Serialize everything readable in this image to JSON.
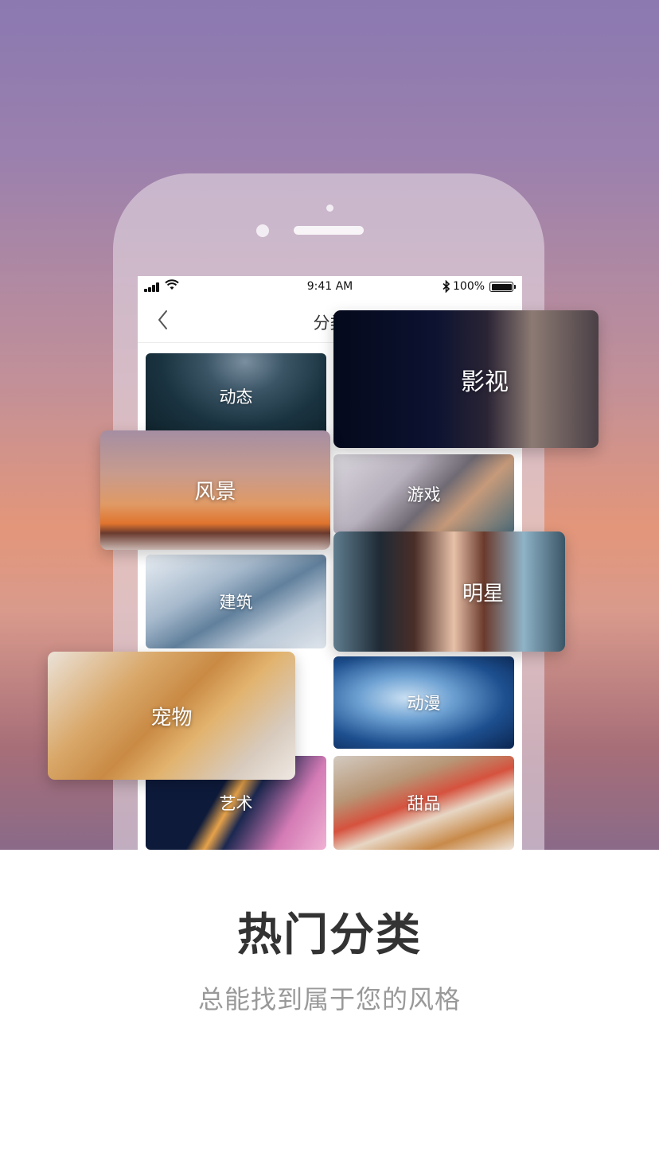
{
  "status_bar": {
    "time": "9:41 AM",
    "bluetooth_icon": "bluetooth-icon",
    "battery_percent": "100%",
    "battery_level": 1.0
  },
  "nav": {
    "back_icon": "chevron-left-icon",
    "title": "分类"
  },
  "categories": {
    "dongtai": "动态",
    "jianzhu": "建筑",
    "yishu": "艺术",
    "youxi": "游戏",
    "dongman": "动漫",
    "tianpin": "甜品"
  },
  "featured": {
    "yingshi": "影视",
    "fengjing": "风景",
    "mingxing": "明星",
    "chongwu": "宠物"
  },
  "promo": {
    "headline": "热门分类",
    "subline": "总能找到属于您的风格"
  }
}
